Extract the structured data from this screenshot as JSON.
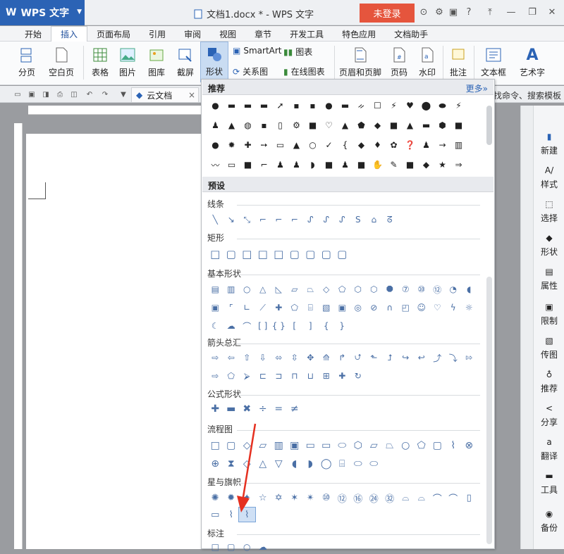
{
  "titlebar": {
    "app_label": "WPS 文字",
    "doc_title": "文档1.docx * - WPS 文字",
    "login": "未登录"
  },
  "menu": {
    "tabs": [
      "开始",
      "插入",
      "页面布局",
      "引用",
      "审阅",
      "视图",
      "章节",
      "开发工具",
      "特色应用",
      "文档助手"
    ],
    "active": 1
  },
  "ribbon": {
    "page_break": "分页",
    "blank_page": "空白页",
    "table": "表格",
    "picture": "图片",
    "gallery": "图库",
    "screenshot": "截屏",
    "shape": "形状",
    "smartart": "SmartArt",
    "chart": "图表",
    "relation": "关系图",
    "online_chart": "在线图表",
    "header_footer": "页眉和页脚",
    "page_no": "页码",
    "watermark": "水印",
    "comment": "批注",
    "textbox": "文本框",
    "wordart": "艺术字"
  },
  "quickbar": {
    "doc_tab": "云文档",
    "right_text": "找命令、搜索模板"
  },
  "sidebar": [
    "新建",
    "样式",
    "选择",
    "形状",
    "属性",
    "限制",
    "传图",
    "推荐",
    "分享",
    "翻译",
    "工具",
    "备份"
  ],
  "panel": {
    "recommend_header": "推荐",
    "more": "更多»",
    "preset_header": "预设",
    "categories": {
      "lines": "线条",
      "rect": "矩形",
      "basic": "基本形状",
      "arrows": "箭头总汇",
      "formula": "公式形状",
      "flow": "流程图",
      "stars": "星与旗帜",
      "callout": "标注"
    }
  }
}
